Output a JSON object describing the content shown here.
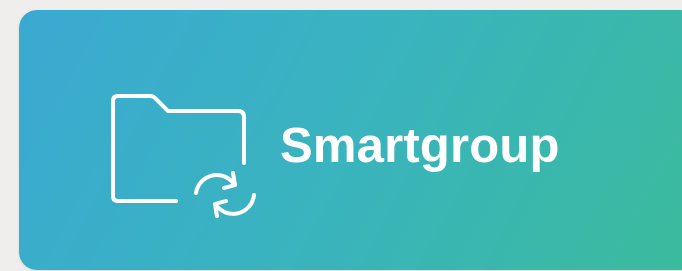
{
  "card": {
    "label": "Smartgroup",
    "icon": "folder-sync-icon",
    "gradient_start": "#3aa9d2",
    "gradient_end": "#3bbb9c",
    "text_color": "#ffffff"
  }
}
